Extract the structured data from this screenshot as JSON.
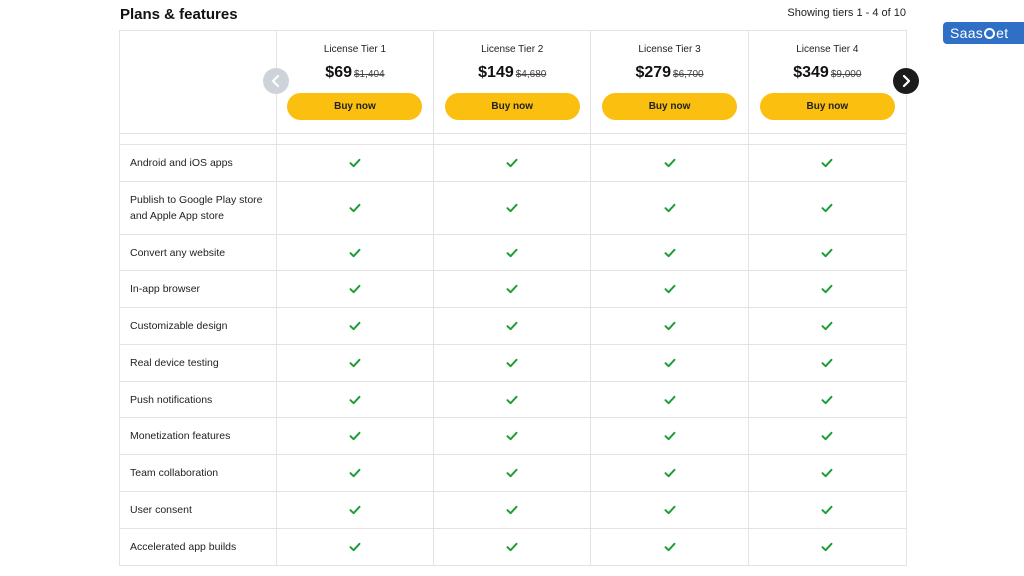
{
  "header": {
    "title": "Plans & features",
    "showing": "Showing tiers 1 - 4 of 10"
  },
  "brand": {
    "pre": "Saas",
    "post": "et"
  },
  "tiers": [
    {
      "name": "License Tier 1",
      "price": "$69",
      "old_price": "$1,404",
      "cta": "Buy now"
    },
    {
      "name": "License Tier 2",
      "price": "$149",
      "old_price": "$4,680",
      "cta": "Buy now"
    },
    {
      "name": "License Tier 3",
      "price": "$279",
      "old_price": "$6,700",
      "cta": "Buy now"
    },
    {
      "name": "License Tier 4",
      "price": "$349",
      "old_price": "$9,000",
      "cta": "Buy now"
    }
  ],
  "features": [
    "Android and iOS apps",
    "Publish to Google Play store and Apple App store",
    "Convert any website",
    "In-app browser",
    "Customizable design",
    "Real device testing",
    "Push notifications",
    "Monetization features",
    "Team collaboration",
    "User consent",
    "Accelerated app builds"
  ],
  "colors": {
    "check": "#1e9e3a",
    "cta": "#fbbf10",
    "brand": "#2f6fc6"
  },
  "icons": {
    "check": "check-icon",
    "prev": "chevron-left-icon",
    "next": "chevron-right-icon"
  }
}
